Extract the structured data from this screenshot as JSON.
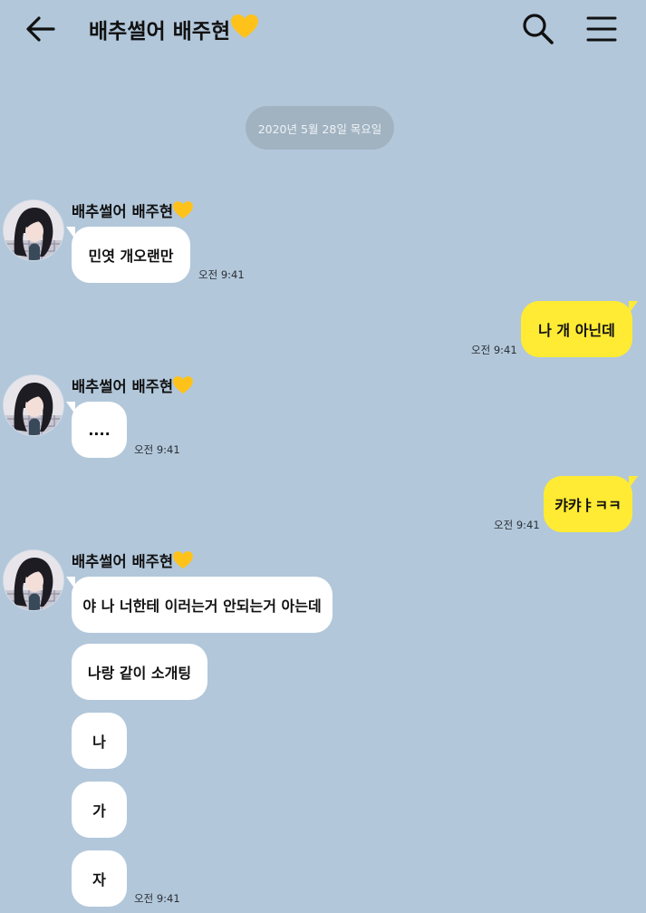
{
  "header": {
    "title": "배추썰어 배주현",
    "heart": "💛",
    "back_icon": "arrow-left-icon",
    "search_icon": "search-icon",
    "menu_icon": "hamburger-menu-icon"
  },
  "date_divider": "2020년 5월 28일 목요일",
  "colors": {
    "background": "#b2c7da",
    "my_bubble": "#ffeb33",
    "their_bubble": "#ffffff",
    "date_pill": "#a1b2c0",
    "heart": "#ffc21a"
  },
  "messages": {
    "g1": {
      "sender": "배추썰어 배주현",
      "bubbles": [
        "민엿 개오랜만"
      ],
      "time": "오전 9:41"
    },
    "m1": {
      "text": "나 개 아닌데",
      "time": "오전 9:41"
    },
    "g2": {
      "sender": "배추썰어 배주현",
      "bubbles": [
        "...."
      ],
      "time": "오전 9:41"
    },
    "m2": {
      "text": "캬캬ㅑㅋㅋ",
      "time": "오전 9:41"
    },
    "g3": {
      "sender": "배추썰어 배주현",
      "bubbles": [
        "야 나 너한테 이러는거 안되는거 아는데",
        "나랑 같이 소개팅",
        "나",
        "가",
        "자"
      ],
      "time": "오전 9:41"
    }
  }
}
